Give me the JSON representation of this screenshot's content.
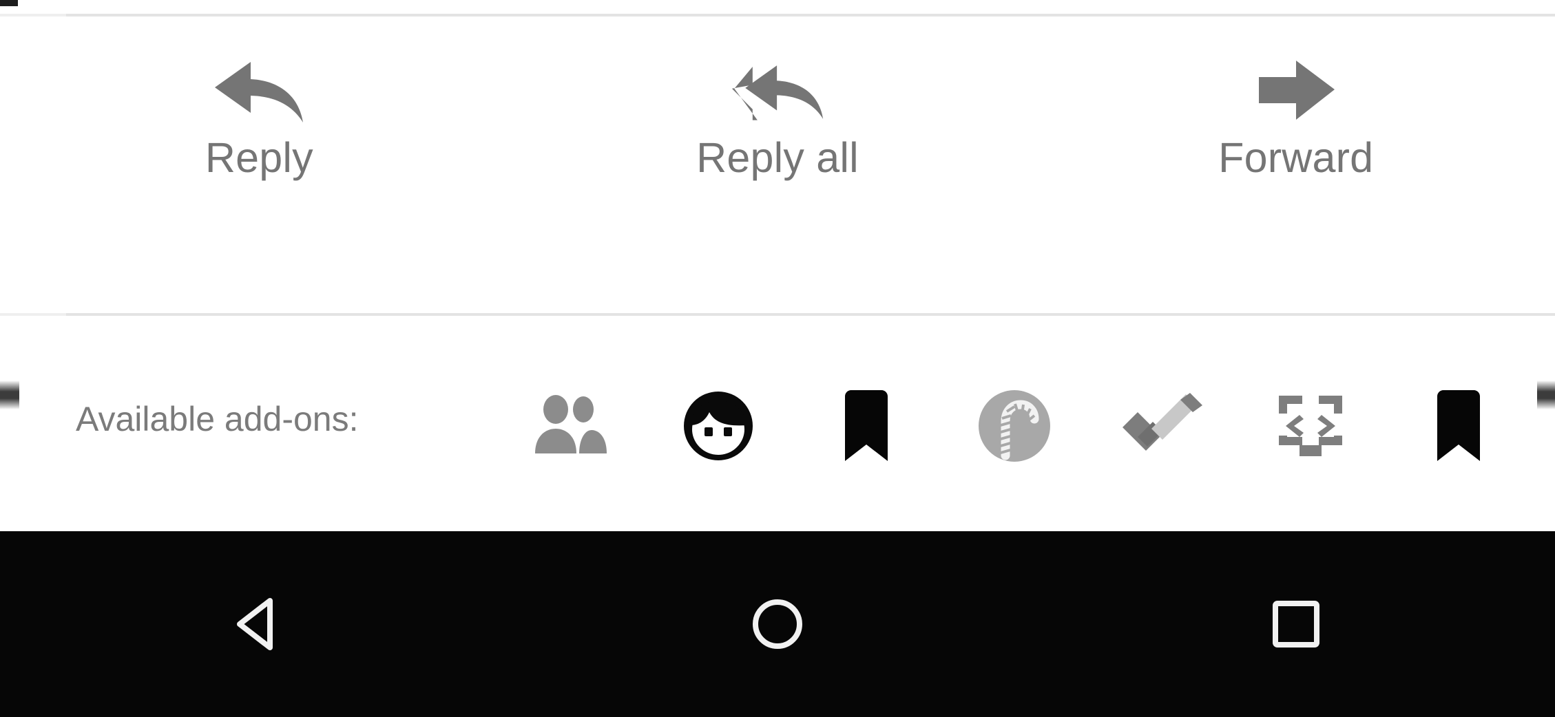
{
  "reply_bar": {
    "actions": [
      {
        "label": "Reply",
        "icon": "reply-icon",
        "name": "reply-button"
      },
      {
        "label": "Reply all",
        "icon": "reply-all-icon",
        "name": "reply-all-button"
      },
      {
        "label": "Forward",
        "icon": "forward-icon",
        "name": "forward-button"
      }
    ]
  },
  "addons_bar": {
    "label": "Available add-ons:",
    "items": [
      {
        "icon": "people-icon",
        "name": "addon-people"
      },
      {
        "icon": "face-icon",
        "name": "addon-face"
      },
      {
        "icon": "bookmark-icon",
        "name": "addon-bookmark-1"
      },
      {
        "icon": "candy-cane-circle-icon",
        "name": "addon-candy-cane"
      },
      {
        "icon": "checkmark-icon",
        "name": "addon-checkmark"
      },
      {
        "icon": "code-brackets-icon",
        "name": "addon-code-brackets"
      },
      {
        "icon": "bookmark-icon",
        "name": "addon-bookmark-2"
      }
    ],
    "edge_left_marker": "scroll-edge-left",
    "edge_right_marker": "scroll-edge-right"
  },
  "navigation_bar": {
    "buttons": [
      {
        "icon": "back-triangle-icon",
        "name": "nav-back-button"
      },
      {
        "icon": "home-circle-icon",
        "name": "nav-home-button"
      },
      {
        "icon": "recents-square-icon",
        "name": "nav-recents-button"
      }
    ]
  },
  "colors": {
    "background": "#ffffff",
    "divider": "#e3e3e3",
    "icon_gray": "#757575",
    "text_gray": "#757575",
    "label_gray": "#7b7b7b",
    "navbar_background": "#060606",
    "navbar_icon": "#f1f1f1",
    "bookmark_black": "#060606"
  }
}
